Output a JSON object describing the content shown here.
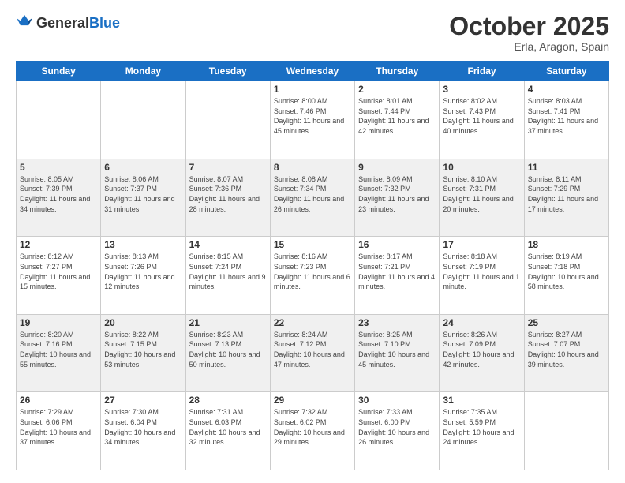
{
  "logo": {
    "general": "General",
    "blue": "Blue"
  },
  "header": {
    "month": "October 2025",
    "location": "Erla, Aragon, Spain"
  },
  "weekdays": [
    "Sunday",
    "Monday",
    "Tuesday",
    "Wednesday",
    "Thursday",
    "Friday",
    "Saturday"
  ],
  "weeks": [
    [
      {
        "day": "",
        "sunrise": "",
        "sunset": "",
        "daylight": ""
      },
      {
        "day": "",
        "sunrise": "",
        "sunset": "",
        "daylight": ""
      },
      {
        "day": "",
        "sunrise": "",
        "sunset": "",
        "daylight": ""
      },
      {
        "day": "1",
        "sunrise": "Sunrise: 8:00 AM",
        "sunset": "Sunset: 7:46 PM",
        "daylight": "Daylight: 11 hours and 45 minutes."
      },
      {
        "day": "2",
        "sunrise": "Sunrise: 8:01 AM",
        "sunset": "Sunset: 7:44 PM",
        "daylight": "Daylight: 11 hours and 42 minutes."
      },
      {
        "day": "3",
        "sunrise": "Sunrise: 8:02 AM",
        "sunset": "Sunset: 7:43 PM",
        "daylight": "Daylight: 11 hours and 40 minutes."
      },
      {
        "day": "4",
        "sunrise": "Sunrise: 8:03 AM",
        "sunset": "Sunset: 7:41 PM",
        "daylight": "Daylight: 11 hours and 37 minutes."
      }
    ],
    [
      {
        "day": "5",
        "sunrise": "Sunrise: 8:05 AM",
        "sunset": "Sunset: 7:39 PM",
        "daylight": "Daylight: 11 hours and 34 minutes."
      },
      {
        "day": "6",
        "sunrise": "Sunrise: 8:06 AM",
        "sunset": "Sunset: 7:37 PM",
        "daylight": "Daylight: 11 hours and 31 minutes."
      },
      {
        "day": "7",
        "sunrise": "Sunrise: 8:07 AM",
        "sunset": "Sunset: 7:36 PM",
        "daylight": "Daylight: 11 hours and 28 minutes."
      },
      {
        "day": "8",
        "sunrise": "Sunrise: 8:08 AM",
        "sunset": "Sunset: 7:34 PM",
        "daylight": "Daylight: 11 hours and 26 minutes."
      },
      {
        "day": "9",
        "sunrise": "Sunrise: 8:09 AM",
        "sunset": "Sunset: 7:32 PM",
        "daylight": "Daylight: 11 hours and 23 minutes."
      },
      {
        "day": "10",
        "sunrise": "Sunrise: 8:10 AM",
        "sunset": "Sunset: 7:31 PM",
        "daylight": "Daylight: 11 hours and 20 minutes."
      },
      {
        "day": "11",
        "sunrise": "Sunrise: 8:11 AM",
        "sunset": "Sunset: 7:29 PM",
        "daylight": "Daylight: 11 hours and 17 minutes."
      }
    ],
    [
      {
        "day": "12",
        "sunrise": "Sunrise: 8:12 AM",
        "sunset": "Sunset: 7:27 PM",
        "daylight": "Daylight: 11 hours and 15 minutes."
      },
      {
        "day": "13",
        "sunrise": "Sunrise: 8:13 AM",
        "sunset": "Sunset: 7:26 PM",
        "daylight": "Daylight: 11 hours and 12 minutes."
      },
      {
        "day": "14",
        "sunrise": "Sunrise: 8:15 AM",
        "sunset": "Sunset: 7:24 PM",
        "daylight": "Daylight: 11 hours and 9 minutes."
      },
      {
        "day": "15",
        "sunrise": "Sunrise: 8:16 AM",
        "sunset": "Sunset: 7:23 PM",
        "daylight": "Daylight: 11 hours and 6 minutes."
      },
      {
        "day": "16",
        "sunrise": "Sunrise: 8:17 AM",
        "sunset": "Sunset: 7:21 PM",
        "daylight": "Daylight: 11 hours and 4 minutes."
      },
      {
        "day": "17",
        "sunrise": "Sunrise: 8:18 AM",
        "sunset": "Sunset: 7:19 PM",
        "daylight": "Daylight: 11 hours and 1 minute."
      },
      {
        "day": "18",
        "sunrise": "Sunrise: 8:19 AM",
        "sunset": "Sunset: 7:18 PM",
        "daylight": "Daylight: 10 hours and 58 minutes."
      }
    ],
    [
      {
        "day": "19",
        "sunrise": "Sunrise: 8:20 AM",
        "sunset": "Sunset: 7:16 PM",
        "daylight": "Daylight: 10 hours and 55 minutes."
      },
      {
        "day": "20",
        "sunrise": "Sunrise: 8:22 AM",
        "sunset": "Sunset: 7:15 PM",
        "daylight": "Daylight: 10 hours and 53 minutes."
      },
      {
        "day": "21",
        "sunrise": "Sunrise: 8:23 AM",
        "sunset": "Sunset: 7:13 PM",
        "daylight": "Daylight: 10 hours and 50 minutes."
      },
      {
        "day": "22",
        "sunrise": "Sunrise: 8:24 AM",
        "sunset": "Sunset: 7:12 PM",
        "daylight": "Daylight: 10 hours and 47 minutes."
      },
      {
        "day": "23",
        "sunrise": "Sunrise: 8:25 AM",
        "sunset": "Sunset: 7:10 PM",
        "daylight": "Daylight: 10 hours and 45 minutes."
      },
      {
        "day": "24",
        "sunrise": "Sunrise: 8:26 AM",
        "sunset": "Sunset: 7:09 PM",
        "daylight": "Daylight: 10 hours and 42 minutes."
      },
      {
        "day": "25",
        "sunrise": "Sunrise: 8:27 AM",
        "sunset": "Sunset: 7:07 PM",
        "daylight": "Daylight: 10 hours and 39 minutes."
      }
    ],
    [
      {
        "day": "26",
        "sunrise": "Sunrise: 7:29 AM",
        "sunset": "Sunset: 6:06 PM",
        "daylight": "Daylight: 10 hours and 37 minutes."
      },
      {
        "day": "27",
        "sunrise": "Sunrise: 7:30 AM",
        "sunset": "Sunset: 6:04 PM",
        "daylight": "Daylight: 10 hours and 34 minutes."
      },
      {
        "day": "28",
        "sunrise": "Sunrise: 7:31 AM",
        "sunset": "Sunset: 6:03 PM",
        "daylight": "Daylight: 10 hours and 32 minutes."
      },
      {
        "day": "29",
        "sunrise": "Sunrise: 7:32 AM",
        "sunset": "Sunset: 6:02 PM",
        "daylight": "Daylight: 10 hours and 29 minutes."
      },
      {
        "day": "30",
        "sunrise": "Sunrise: 7:33 AM",
        "sunset": "Sunset: 6:00 PM",
        "daylight": "Daylight: 10 hours and 26 minutes."
      },
      {
        "day": "31",
        "sunrise": "Sunrise: 7:35 AM",
        "sunset": "Sunset: 5:59 PM",
        "daylight": "Daylight: 10 hours and 24 minutes."
      },
      {
        "day": "",
        "sunrise": "",
        "sunset": "",
        "daylight": ""
      }
    ]
  ]
}
